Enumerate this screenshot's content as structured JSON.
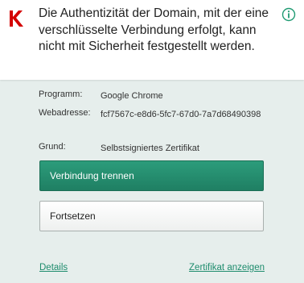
{
  "colors": {
    "accent": "#1f7f63",
    "link": "#1e8c6d",
    "brand_red": "#d40000",
    "info_green": "#1f9a72"
  },
  "header": {
    "logo_icon": "kaspersky-k-logo",
    "info_icon": "info-icon",
    "message": "Die Authentizität der Domain, mit der eine verschlüsselte Verbindung erfolgt, kann nicht mit Sicherheit festgestellt werden."
  },
  "details": {
    "program_label": "Programm:",
    "program_value": "Google Chrome",
    "address_label": "Webadresse:",
    "address_value": "fcf7567c-e8d6-5fc7-67d0-7a7d68490398",
    "reason_label": "Grund:",
    "reason_value": "Selbstsigniertes Zertifikat"
  },
  "actions": {
    "disconnect_label": "Verbindung trennen",
    "continue_label": "Fortsetzen"
  },
  "links": {
    "details_label": "Details",
    "certificate_label": "Zertifikat anzeigen"
  }
}
